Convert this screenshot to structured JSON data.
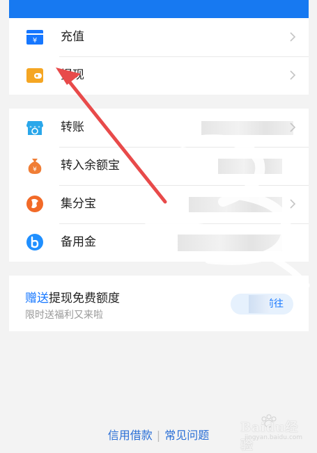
{
  "section1": {
    "items": [
      {
        "label": "充值",
        "icon": "recharge-yuan-icon",
        "color": "#1677ff"
      },
      {
        "label": "提现",
        "icon": "wallet-icon",
        "color": "#f5a623"
      }
    ]
  },
  "section2": {
    "items": [
      {
        "label": "转账",
        "icon": "transfer-shop-icon",
        "color": "#2aa7ea"
      },
      {
        "label": "转入余额宝",
        "icon": "money-bag-icon",
        "color": "#f07d35"
      },
      {
        "label": "集分宝",
        "icon": "points-icon",
        "color": "#f26a28"
      },
      {
        "label": "备用金",
        "icon": "letter-b-icon",
        "color": "#1f8fff"
      }
    ]
  },
  "promo": {
    "title_accent": "赠送",
    "title_rest": "提现免费额度",
    "subtitle": "限时送福利又来啦",
    "button_label": "前往"
  },
  "footer": {
    "link1": "信用借款",
    "separator": "|",
    "link2": "常见问题"
  },
  "watermark": {
    "text": "Baidu经验",
    "sub": "jingyan.baidu.com"
  },
  "colors": {
    "topbar": "#1779f1",
    "accent": "#1677ff",
    "arrow": "#e84a4a"
  }
}
